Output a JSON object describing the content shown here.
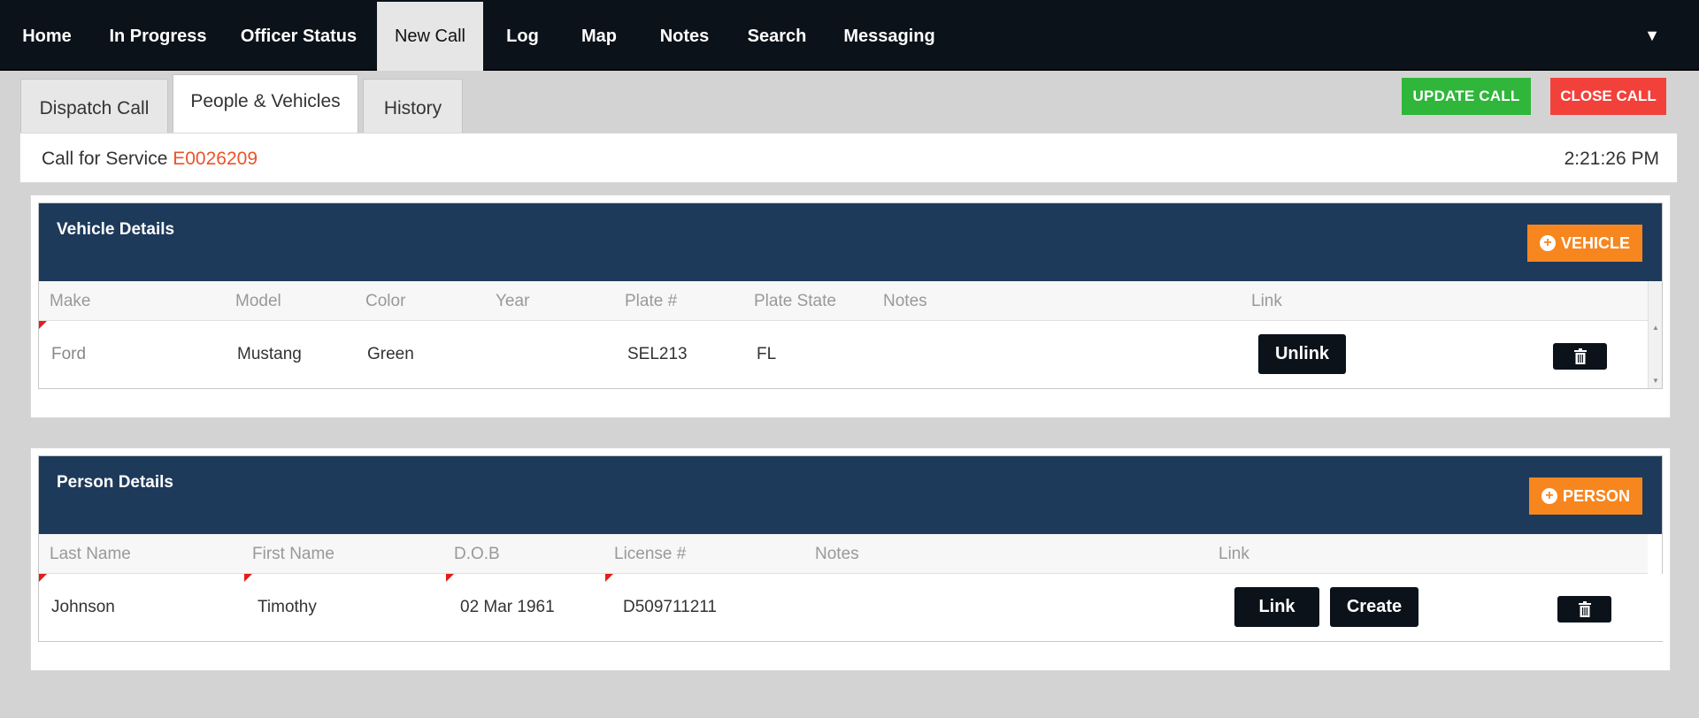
{
  "nav": {
    "items": [
      "Home",
      "In Progress",
      "Officer Status",
      "New Call",
      "Log",
      "Map",
      "Notes",
      "Search",
      "Messaging"
    ],
    "active": "New Call",
    "menu_icon": "caret-down-icon"
  },
  "tabs": {
    "dispatch": "Dispatch Call",
    "people": "People & Vehicles",
    "history": "History",
    "active": "People & Vehicles"
  },
  "actions": {
    "update": "UPDATE CALL",
    "close": "CLOSE CALL"
  },
  "call": {
    "label": "Call for Service",
    "number": "E0026209",
    "time": "2:21:26 PM"
  },
  "vehicles": {
    "title": "Vehicle Details",
    "add_label": "VEHICLE",
    "columns": [
      "Make",
      "Model",
      "Color",
      "Year",
      "Plate #",
      "Plate State",
      "Notes",
      "Link"
    ],
    "rows": [
      {
        "make": "Ford",
        "model": "Mustang",
        "color": "Green",
        "year": "",
        "plate": "SEL213",
        "state": "FL",
        "notes": "",
        "link_label": "Unlink"
      }
    ]
  },
  "persons": {
    "title": "Person Details",
    "add_label": "PERSON",
    "columns": [
      "Last Name",
      "First Name",
      "D.O.B",
      "License #",
      "Notes",
      "Link"
    ],
    "rows": [
      {
        "last": "Johnson",
        "first": "Timothy",
        "dob": "02 Mar 1961",
        "license": "D509711211",
        "notes": "",
        "link_label": "Link",
        "create_label": "Create"
      }
    ]
  },
  "colors": {
    "nav_bg": "#0b1219",
    "panel_head": "#1e3a5a",
    "update": "#2fb63b",
    "close": "#f2413a",
    "add": "#f7861e",
    "call_number": "#e8542c"
  }
}
